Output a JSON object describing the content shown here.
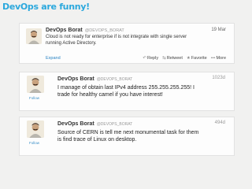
{
  "slide": {
    "title": "DevOps are funny!"
  },
  "tweets": [
    {
      "name": "DevOps Borat",
      "handle": "@DEVOPS_BORAT",
      "date": "19 Mar",
      "lines": [
        "Cloud is not ready for enterprise if is not integrate with single server",
        "running Active Directory."
      ],
      "expand": "Expand",
      "actions": {
        "reply": "Reply",
        "retweet": "Retweet",
        "favorite": "Favorite",
        "more": "More"
      }
    },
    {
      "name": "DevOps Borat",
      "handle": "@DEVOPS_BORAT",
      "date": "1023d",
      "follow": "Follow",
      "lines": [
        "I manage of obtain last IPv4 address 255.255.255.255! I",
        "trade for healthy camel if you have interest!"
      ]
    },
    {
      "name": "DevOps Borat",
      "handle": "@DEVOPS_BORAT",
      "date": "494d",
      "follow": "Follow",
      "lines": [
        "Source of CERN is tell me next monumental task for them",
        "is find trace of Linux on desktop."
      ]
    }
  ]
}
